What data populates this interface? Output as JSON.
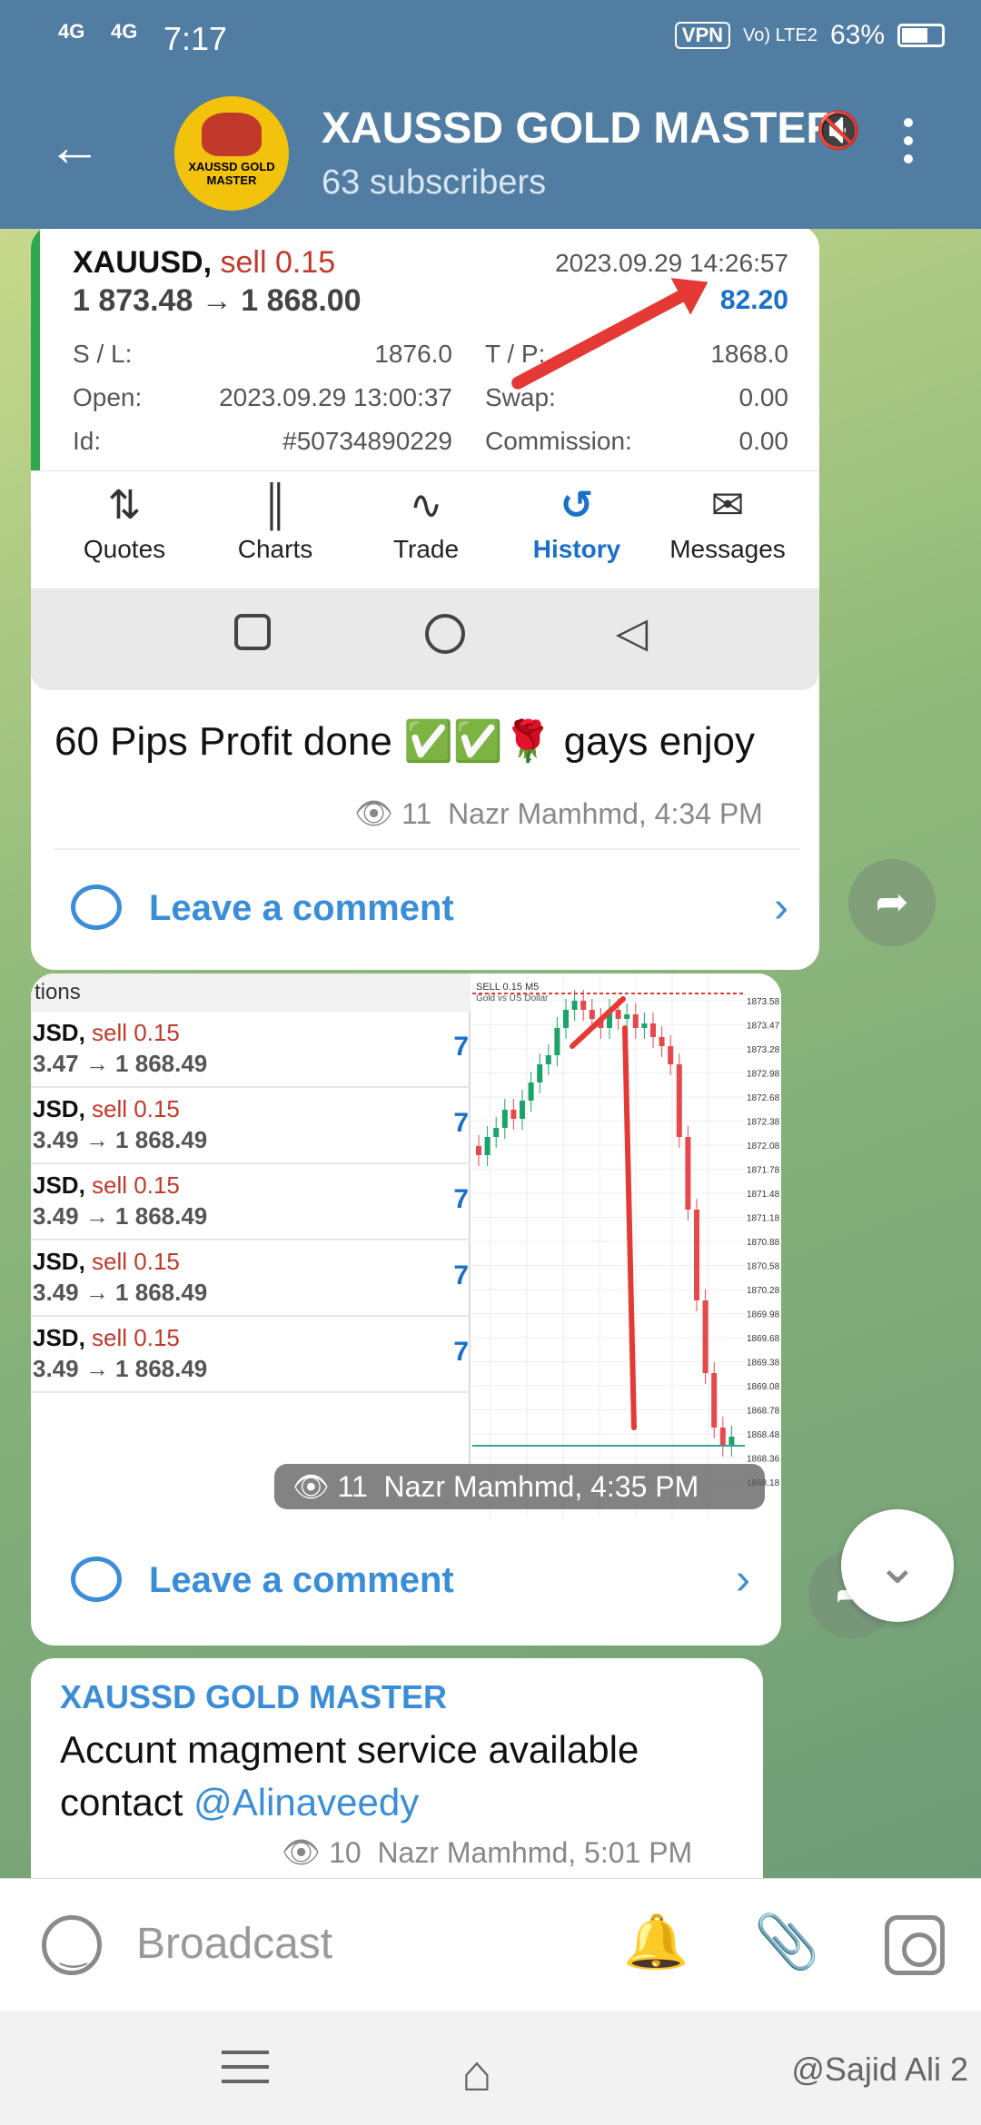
{
  "status": {
    "sig1": "4G",
    "sig2": "4G",
    "time": "7:17",
    "vpn": "VPN",
    "volte": "Vo) LTE2",
    "battery": "63%"
  },
  "header": {
    "back_icon": "arrow-left-icon",
    "avatar_text": "XAUSSD GOLD MASTER",
    "title": "XAUSSD GOLD MASTER",
    "subtitle": "63 subscribers",
    "mute_icon": "muted-speaker-icon",
    "menu_icon": "more-vertical-icon"
  },
  "post1": {
    "trade": {
      "symbol": "XAUUSD,",
      "side": "sell 0.15",
      "prices": "1 873.48 → 1 868.00",
      "date": "2023.09.29 14:26:57",
      "profit": "82.20",
      "sl_label": "S / L:",
      "sl_value": "1876.0",
      "tp_label": "T / P:",
      "tp_value": "1868.0",
      "open_label": "Open:",
      "open_value": "2023.09.29 13:00:37",
      "swap_label": "Swap:",
      "swap_value": "0.00",
      "id_label": "Id:",
      "id_value": "#50734890229",
      "comm_label": "Commission:",
      "comm_value": "0.00"
    },
    "tabs": [
      {
        "label": "Quotes",
        "icon": "⇅"
      },
      {
        "label": "Charts",
        "icon": "║"
      },
      {
        "label": "Trade",
        "icon": "∿"
      },
      {
        "label": "History",
        "icon": "↺"
      },
      {
        "label": "Messages",
        "icon": "✉"
      }
    ],
    "text": "60 Pips Profit done ✅✅🌹 gays enjoy",
    "views": "11",
    "meta": "Nazr Mamhmd, 4:34 PM",
    "comment_label": "Leave a comment"
  },
  "post2": {
    "orders_head": "tions",
    "orders": [
      {
        "sym": "JSD,",
        "side": "sell 0.15",
        "prices": "3.47 → 1 868.49",
        "v": "7"
      },
      {
        "sym": "JSD,",
        "side": "sell 0.15",
        "prices": "3.49 → 1 868.49",
        "v": "7"
      },
      {
        "sym": "JSD,",
        "side": "sell 0.15",
        "prices": "3.49 → 1 868.49",
        "v": "7"
      },
      {
        "sym": "JSD,",
        "side": "sell 0.15",
        "prices": "3.49 → 1 868.49",
        "v": "7"
      },
      {
        "sym": "JSD,",
        "side": "sell 0.15",
        "prices": "3.49 → 1 868.49",
        "v": "7"
      }
    ],
    "chart_labels": [
      "1873.58",
      "1873.47",
      "1873.28",
      "1872.98",
      "1872.68",
      "1872.38",
      "1872.08",
      "1871.78",
      "1871.48",
      "1871.18",
      "1870.88",
      "1870.58",
      "1870.28",
      "1869.98",
      "1869.68",
      "1869.38",
      "1869.08",
      "1868.78",
      "1868.48",
      "1868.36",
      "1868.18"
    ],
    "chart_title": "SELL 0.15 M5",
    "chart_sub": "Gold vs US Dollar",
    "views": "11",
    "meta": "Nazr Mamhmd, 4:35 PM",
    "comment_label": "Leave a comment"
  },
  "post3": {
    "author": "XAUSSD GOLD MASTER",
    "text": "Accunt magment service available contact ",
    "mention": "@Alinaveedy",
    "views": "10",
    "meta": "Nazr Mamhmd, 5:01 PM"
  },
  "input": {
    "placeholder": "Broadcast",
    "bell_icon": "bell-icon",
    "clip_icon": "paperclip-icon",
    "cam_icon": "instagram-icon"
  },
  "watermark": "@Sajid Ali 2"
}
